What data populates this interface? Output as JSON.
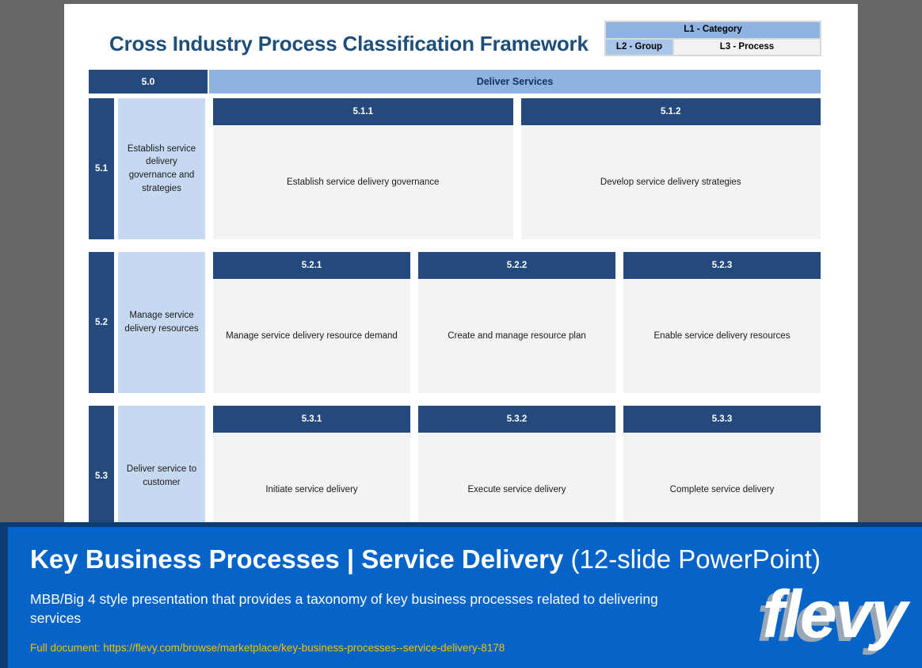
{
  "slide": {
    "title": "Cross Industry Process Classification Framework",
    "legend": {
      "l1": "L1 - Category",
      "l2": "L2 - Group",
      "l3": "L3 - Process"
    },
    "category": {
      "number": "5.0",
      "name": "Deliver Services"
    },
    "groups": [
      {
        "number": "5.1",
        "name": "Establish service delivery governance and strategies",
        "processes": [
          {
            "number": "5.1.1",
            "name": "Establish service delivery governance"
          },
          {
            "number": "5.1.2",
            "name": "Develop service delivery strategies"
          }
        ]
      },
      {
        "number": "5.2",
        "name": "Manage service delivery resources",
        "processes": [
          {
            "number": "5.2.1",
            "name": "Manage service delivery resource demand"
          },
          {
            "number": "5.2.2",
            "name": "Create and manage resource plan"
          },
          {
            "number": "5.2.3",
            "name": "Enable service delivery resources"
          }
        ]
      },
      {
        "number": "5.3",
        "name": "Deliver service to customer",
        "processes": [
          {
            "number": "5.3.1",
            "name": "Initiate service delivery"
          },
          {
            "number": "5.3.2",
            "name": "Execute service delivery"
          },
          {
            "number": "5.3.3",
            "name": "Complete service delivery"
          }
        ]
      }
    ],
    "colors": {
      "dark_navy": "#24497c",
      "category_blue": "#8eb3e3",
      "group_light_blue": "#c7d9f1",
      "process_gray": "#f3f3f3",
      "title_blue": "#1f4e79"
    }
  },
  "banner": {
    "title_main": "Key Business Processes | Service Delivery",
    "title_sub": "(12-slide PowerPoint)",
    "description": "MBB/Big 4 style presentation that provides a taxonomy of key business processes related to delivering services",
    "url_label": "Full document: https://flevy.com/browse/marketplace/key-business-processes--service-delivery-8178",
    "logo_text": "flevy",
    "colors": {
      "banner_blue": "#0664c8",
      "banner_edge": "#0b3c73",
      "url_yellow": "#f2c200"
    }
  }
}
